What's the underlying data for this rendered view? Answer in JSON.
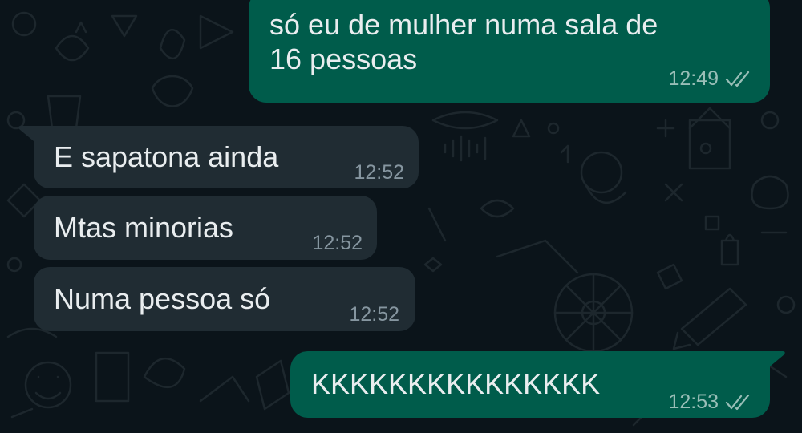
{
  "messages": [
    {
      "direction": "out",
      "text": "só eu de mulher numa sala de\n16 pessoas",
      "time": "12:49",
      "status": "read"
    },
    {
      "direction": "in",
      "text": "E sapatona ainda",
      "time": "12:52"
    },
    {
      "direction": "in",
      "text": "Mtas minorias",
      "time": "12:52"
    },
    {
      "direction": "in",
      "text": "Numa pessoa só",
      "time": "12:52"
    },
    {
      "direction": "out",
      "text": "KKKKKKKKKKKKKKK",
      "time": "12:53",
      "status": "read"
    }
  ],
  "colors": {
    "background": "#0b141a",
    "incoming_bubble": "#202c33",
    "outgoing_bubble": "#005c4b",
    "text": "#e9edef",
    "incoming_meta": "#8696a0",
    "outgoing_meta": "#99beb7"
  },
  "icons": [
    "double-check-icon"
  ]
}
